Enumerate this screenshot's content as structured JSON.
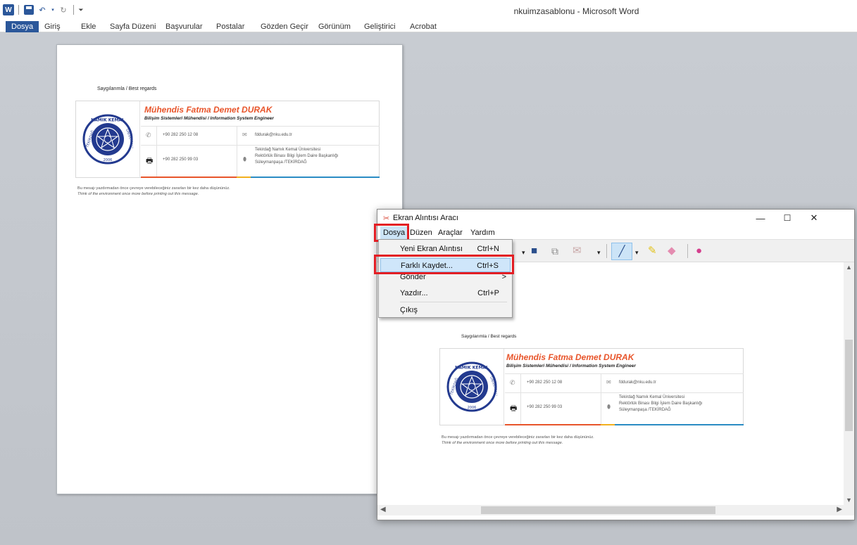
{
  "word": {
    "title": "nkuimzasablonu - Microsoft Word",
    "tabs": [
      "Dosya",
      "Giriş",
      "Ekle",
      "Sayfa Düzeni",
      "Başvurular",
      "Postalar",
      "Gözden Geçir",
      "Görünüm",
      "Geliştirici",
      "Acrobat"
    ]
  },
  "signature": {
    "regards": "Saygılarımla / Best regards",
    "name": "Mühendis Fatma Demet DURAK",
    "role": "Bilişim Sistemleri Mühendisi / Information System Engineer",
    "phone": "+90 282 250 12 08",
    "fax": "+90 282 250 99 03",
    "email": "fddurak@nku.edu.tr",
    "address_1": "Tekirdağ Namık Kemal Üniversitesi",
    "address_2": "Rektörlük Binası Bilgi İşlem Daire Başkanlığı",
    "address_3": "Süleymanpaşa /TEKİRDAĞ",
    "note_1": "Bu mesajı yazdırmadan önce çevreye verebileceğiniz zararları bir kez daha düşününüz.",
    "note_2": "Think of the environment once more before printing out this message.",
    "seal_top": "NAMIK KEMAL",
    "seal_left": "TEKİRDAĞ",
    "seal_right": "ÜNİVERSİTESİ",
    "seal_year": "2006",
    "accent_colors": [
      "#e8542a",
      "#f2b01e",
      "#2a8cc4",
      "#3aa65a"
    ]
  },
  "snip": {
    "title": "Ekran Alıntısı Aracı",
    "menus": [
      "Dosya",
      "Düzen",
      "Araçlar",
      "Yardım"
    ],
    "dropdown": [
      {
        "label": "Yeni Ekran Alıntısı",
        "shortcut": "Ctrl+N"
      },
      {
        "label": "Farklı Kaydet...",
        "shortcut": "Ctrl+S"
      },
      {
        "label": "Gönder",
        "shortcut": ">"
      },
      {
        "label": "Yazdır...",
        "shortcut": "Ctrl+P"
      },
      {
        "label": "Çıkış",
        "shortcut": ""
      }
    ],
    "window_buttons": {
      "minimize": "—",
      "maximize": "☐",
      "close": "✕"
    },
    "highlight_color": "#e31e24"
  }
}
